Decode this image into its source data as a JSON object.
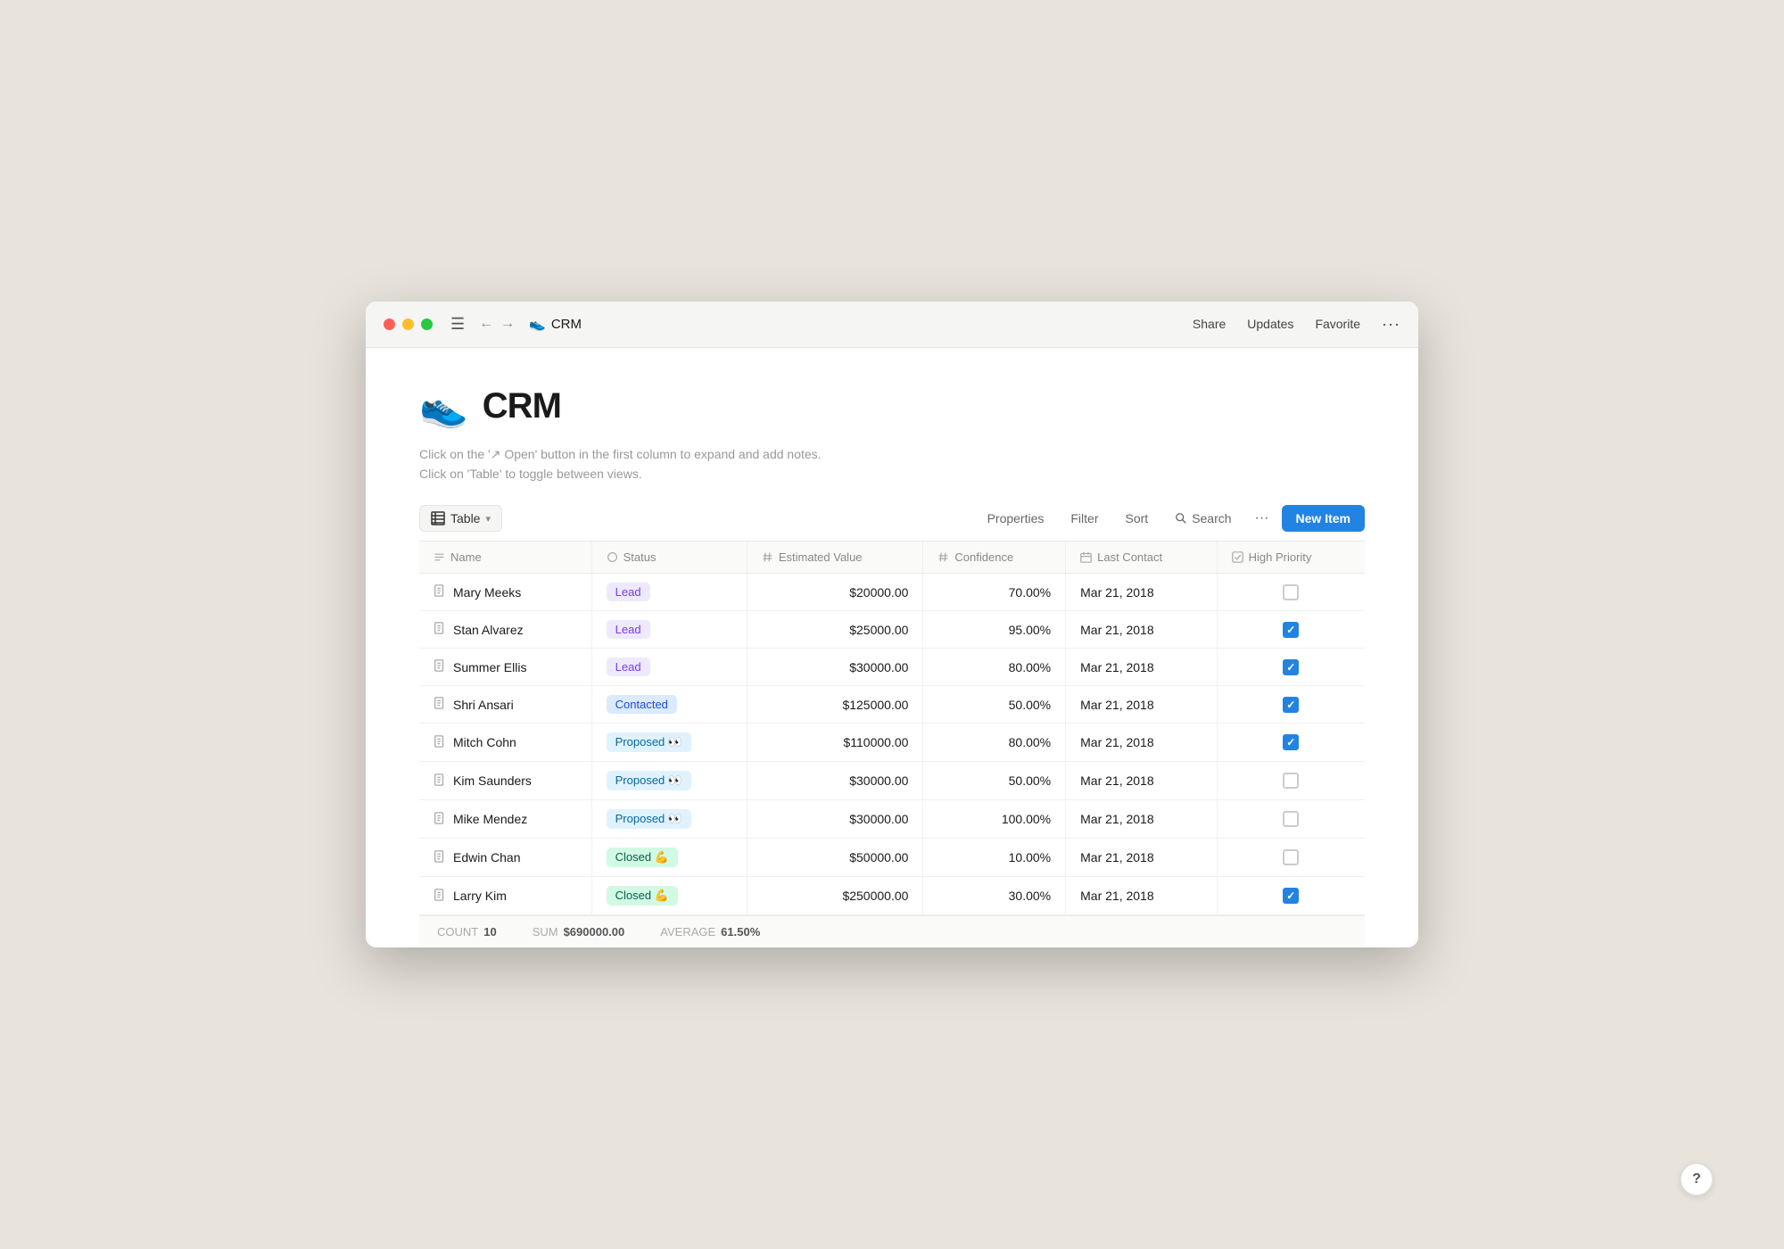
{
  "window": {
    "title": "CRM",
    "icon": "👟",
    "traffic_lights": [
      "red",
      "yellow",
      "green"
    ]
  },
  "titlebar": {
    "brand_icon": "👟",
    "brand_label": "CRM",
    "share": "Share",
    "updates": "Updates",
    "favorite": "Favorite"
  },
  "page": {
    "icon": "👟",
    "title": "CRM",
    "description_line1": "Click on the '↗ Open' button in the first column to expand and add notes.",
    "description_line2": "Click on 'Table' to toggle between views."
  },
  "toolbar": {
    "view_label": "Table",
    "properties": "Properties",
    "filter": "Filter",
    "sort": "Sort",
    "search": "Search",
    "new_item": "New Item"
  },
  "columns": [
    {
      "key": "name",
      "label": "Name",
      "icon": "text"
    },
    {
      "key": "status",
      "label": "Status",
      "icon": "tag"
    },
    {
      "key": "estimated_value",
      "label": "Estimated Value",
      "icon": "hash"
    },
    {
      "key": "confidence",
      "label": "Confidence",
      "icon": "hash"
    },
    {
      "key": "last_contact",
      "label": "Last Contact",
      "icon": "calendar"
    },
    {
      "key": "high_priority",
      "label": "High Priority",
      "icon": "checkbox"
    }
  ],
  "rows": [
    {
      "id": 1,
      "name": "Mary Meeks",
      "status": "Lead",
      "status_type": "lead",
      "estimated_value": "$20000.00",
      "confidence": "70.00%",
      "last_contact": "Mar 21, 2018",
      "high_priority": false
    },
    {
      "id": 2,
      "name": "Stan Alvarez",
      "status": "Lead",
      "status_type": "lead",
      "estimated_value": "$25000.00",
      "confidence": "95.00%",
      "last_contact": "Mar 21, 2018",
      "high_priority": true
    },
    {
      "id": 3,
      "name": "Summer Ellis",
      "status": "Lead",
      "status_type": "lead",
      "estimated_value": "$30000.00",
      "confidence": "80.00%",
      "last_contact": "Mar 21, 2018",
      "high_priority": true
    },
    {
      "id": 4,
      "name": "Shri Ansari",
      "status": "Contacted",
      "status_type": "contacted",
      "estimated_value": "$125000.00",
      "confidence": "50.00%",
      "last_contact": "Mar 21, 2018",
      "high_priority": true
    },
    {
      "id": 5,
      "name": "Mitch Cohn",
      "status": "Proposed 👀",
      "status_type": "proposed",
      "estimated_value": "$110000.00",
      "confidence": "80.00%",
      "last_contact": "Mar 21, 2018",
      "high_priority": true
    },
    {
      "id": 6,
      "name": "Kim Saunders",
      "status": "Proposed 👀",
      "status_type": "proposed",
      "estimated_value": "$30000.00",
      "confidence": "50.00%",
      "last_contact": "Mar 21, 2018",
      "high_priority": false
    },
    {
      "id": 7,
      "name": "Mike Mendez",
      "status": "Proposed 👀",
      "status_type": "proposed",
      "estimated_value": "$30000.00",
      "confidence": "100.00%",
      "last_contact": "Mar 21, 2018",
      "high_priority": false
    },
    {
      "id": 8,
      "name": "Edwin Chan",
      "status": "Closed 💪",
      "status_type": "closed",
      "estimated_value": "$50000.00",
      "confidence": "10.00%",
      "last_contact": "Mar 21, 2018",
      "high_priority": false
    },
    {
      "id": 9,
      "name": "Larry Kim",
      "status": "Closed 💪",
      "status_type": "closed",
      "estimated_value": "$250000.00",
      "confidence": "30.00%",
      "last_contact": "Mar 21, 2018",
      "high_priority": true
    }
  ],
  "footer": {
    "count_label": "COUNT",
    "count_value": "10",
    "sum_label": "SUM",
    "sum_value": "$690000.00",
    "average_label": "AVERAGE",
    "average_value": "61.50%"
  }
}
